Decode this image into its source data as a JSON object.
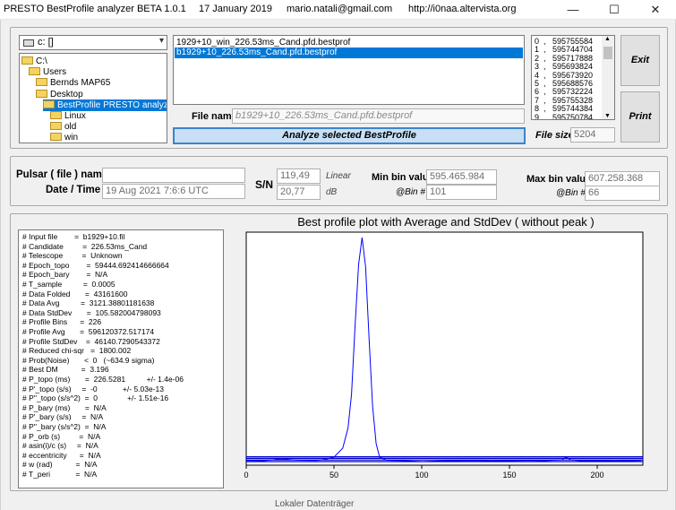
{
  "app": {
    "title": "PRESTO BestProfile analyzer BETA 1.0.1",
    "date": "17 January 2019",
    "email": "mario.natali@gmail.com",
    "url": "http://i0naa.altervista.org"
  },
  "window_controls": {
    "minimize": "—",
    "maximize": "☐",
    "close": "✕"
  },
  "drive": {
    "value": "c: []"
  },
  "directories": [
    {
      "label": "C:\\",
      "selected": false
    },
    {
      "label": "Users",
      "selected": false
    },
    {
      "label": "Bernds MAP65",
      "selected": false
    },
    {
      "label": "Desktop",
      "selected": false
    },
    {
      "label": "BestProfile PRESTO analyzer 1.0.1.e",
      "selected": true
    },
    {
      "label": "Linux",
      "selected": false
    },
    {
      "label": "old",
      "selected": false
    },
    {
      "label": "win",
      "selected": false
    }
  ],
  "files": [
    {
      "name": "1929+10_win_226.53ms_Cand.pfd.bestprof",
      "selected": false
    },
    {
      "name": "b1929+10_226.53ms_Cand.pfd.bestprof",
      "selected": true
    }
  ],
  "file_name": {
    "label": "File name",
    "value": "b1929+10_226.53ms_Cand.pfd.bestprof"
  },
  "analyze_button": "Analyze selected BestProfile",
  "file_size": {
    "label": "File size",
    "value": "5204"
  },
  "peak_list": [
    "0  ,   595755584",
    "1  ,   595744704",
    "2  ,   595717888",
    "3  ,   595693824",
    "4  ,   595673920",
    "5  ,   595688576",
    "6  ,   595732224",
    "7  ,   595755328",
    "8  ,   595744384",
    "9  ,   595750784"
  ],
  "buttons": {
    "exit": "Exit",
    "print": "Print"
  },
  "pulsar": {
    "name_label": "Pulsar ( file ) name",
    "name_value": "",
    "date_label": "Date / Time",
    "date_value": "19 Aug 2021    7:6:6  UTC",
    "sn_label": "S/N",
    "sn_linear": "119,49",
    "sn_linear_unit": "Linear",
    "sn_db": "20,77",
    "sn_db_unit": "dB",
    "min_label": "Min bin value",
    "min_value": "595.465.984",
    "min_bin_label": "@Bin #",
    "min_bin_value": "101",
    "max_label": "Max bin value",
    "max_value": "607.258.368",
    "max_bin_label": "@Bin #",
    "max_bin_value": "66"
  },
  "info_lines": [
    "# Input file        =  b1929+10.fil",
    "# Candidate         =  226.53ms_Cand",
    "# Telescope         =  Unknown",
    "# Epoch_topo        =  59444.692414666664",
    "# Epoch_bary        =  N/A",
    "# T_sample          =  0.0005",
    "# Data Folded       =  43161600",
    "# Data Avg          =  3121.38801181638",
    "# Data StdDev       =  105.582004798093",
    "# Profile Bins      =  226",
    "# Profile Avg       =  596120372.517174",
    "# Profile StdDev    =  46140.7290543372",
    "# Reduced chi-sqr   =  1800.002",
    "# Prob(Noise)       <  0   (~634.9 sigma)",
    "# Best DM           =  3.196",
    "# P_topo (ms)       =  226.5281          +/- 1.4e-06",
    "# P'_topo (s/s)     =  -0            +/- 5.03e-13",
    "# P''_topo (s/s^2)  =  0              +/- 1.51e-16",
    "# P_bary (ms)       =  N/A",
    "# P'_bary (s/s)     =  N/A",
    "# P''_bary (s/s^2)  =  N/A",
    "# P_orb (s)         =  N/A",
    "# asin(i)/c (s)     =  N/A",
    "# eccentricity      =  N/A",
    "# w (rad)           =  N/A",
    "# T_peri            =  N/A"
  ],
  "taskbar_hint": "Lokaler Datenträger",
  "colors": {
    "accent": "#0078d7",
    "profile_line": "#0000ff",
    "band": "#0000cc"
  },
  "chart_data": {
    "type": "line",
    "title": "Best profile plot with  Average and StdDev ( without peak )",
    "xlabel": "",
    "ylabel": "",
    "xlim": [
      0,
      226
    ],
    "xticks": [
      0,
      50,
      100,
      150,
      200
    ],
    "series": [
      {
        "x": [
          0,
          10,
          20,
          30,
          40,
          45,
          50,
          55,
          58,
          60,
          62,
          64,
          66,
          68,
          70,
          72,
          74,
          76,
          80,
          90,
          100,
          101,
          110,
          120,
          130,
          140,
          150,
          160,
          170,
          180,
          182,
          185,
          190,
          200,
          210,
          220,
          225
        ],
        "y": [
          0.005,
          0.004,
          0.012,
          0.006,
          0.005,
          0.01,
          0.02,
          0.06,
          0.15,
          0.3,
          0.6,
          0.88,
          1.0,
          0.87,
          0.55,
          0.25,
          0.08,
          0.02,
          0.006,
          0.004,
          0.0,
          0.0,
          0.003,
          0.004,
          0.005,
          0.003,
          0.004,
          0.005,
          0.004,
          0.008,
          0.02,
          0.008,
          0.004,
          0.004,
          0.003,
          0.004,
          0.005
        ]
      }
    ]
  }
}
